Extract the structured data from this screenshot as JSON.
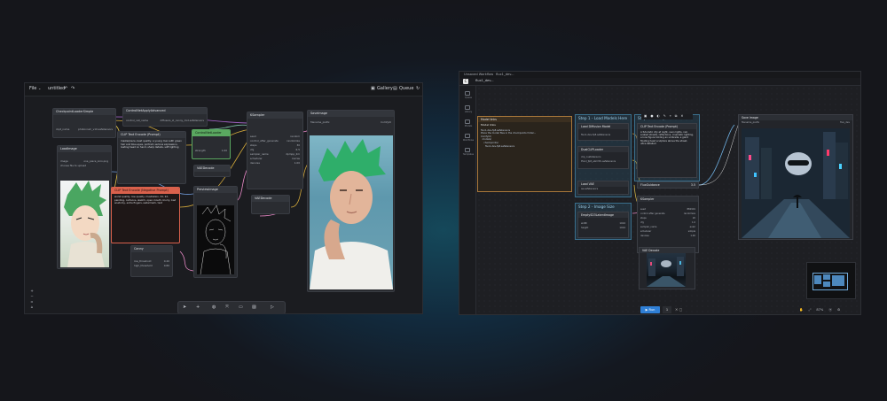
{
  "left_window": {
    "menu": {
      "file": "File",
      "file_chevron": "chevron-down-icon",
      "workflow": "untitled"
    },
    "top_right": {
      "gallery": "Gallery",
      "queue": "Queue"
    },
    "nodes": {
      "checkpoint": {
        "title": "CheckpointLoaderSimple",
        "ckpt_name": "ckpt_name",
        "ckpt_value": "photonium_v10.safetensors"
      },
      "controlnet_apply": {
        "title": "ControlNetApplyAdvanced",
        "field": "control_net_name",
        "value": "diffusers_xl_canny_mid.safetensors"
      },
      "clip_pos": {
        "title": "CLIP Text Encode (Prompt)",
        "text": "masterpiece, best quality, a young man with green hair and blue-eyes, portrait, serious expression, resting head on hand, sharp details, soft lighting"
      },
      "clip_neg": {
        "title": "CLIP Text Encode (Negative Prompt)",
        "text": "worst quality, low quality, illustration, 3d, 2d, painting, cartoons, sketch, open mouth, blurry, bad anatomy, extra fingers, watermark, text"
      },
      "load_image": {
        "title": "LoadImage",
        "image_label": "image",
        "image_value": "one_piece_zoro.png",
        "upload": "choose file to upload"
      },
      "canny": {
        "title": "Canny",
        "low": "low_threshold",
        "low_v": "0.40",
        "high": "high_threshold",
        "high_v": "0.80"
      },
      "green": {
        "title": "ControlNetLoader",
        "strength": "strength",
        "strength_v": "1.00"
      },
      "vae_decode": {
        "title": "VAEDecode"
      },
      "preview": {
        "title": "PreviewImage"
      },
      "ksampler": {
        "title": "KSampler",
        "rows": [
          {
            "k": "seed",
            "v": "random"
          },
          {
            "k": "control_after_generate",
            "v": "randomize"
          },
          {
            "k": "steps",
            "v": "30"
          },
          {
            "k": "cfg",
            "v": "6.5"
          },
          {
            "k": "sampler_name",
            "v": "dpmpp_2m"
          },
          {
            "k": "scheduler",
            "v": "karras"
          },
          {
            "k": "denoise",
            "v": "1.00"
          }
        ]
      },
      "vae_encode": {
        "title": "VAEDecode"
      },
      "save_image": {
        "title": "SaveImage",
        "prefix": "filename_prefix",
        "prefix_v": "ComfyUI"
      }
    },
    "toolbar": {
      "icons": [
        "select-icon",
        "add-icon",
        "globe-icon",
        "fit-icon",
        "lock-icon",
        "image-icon",
        "play-icon"
      ]
    }
  },
  "right_window": {
    "tabs": [
      "Unsaved Workflow",
      "flux1_dev..."
    ],
    "subtab": "flux1_dev...",
    "sidebar": [
      {
        "icon": "queue-icon",
        "label": "Queue"
      },
      {
        "icon": "library-icon",
        "label": "Library"
      },
      {
        "icon": "model-icon",
        "label": "Models"
      },
      {
        "icon": "workflow-icon",
        "label": "Workflows"
      },
      {
        "icon": "templates-icon",
        "label": "Templates"
      }
    ],
    "model_links": {
      "title": "Model links",
      "label": "Model links",
      "text": "flux1-dev-fp8.safetensors\nPlace the model files in the checkpoints folder...\nComfyUI/\n  models/\n    checkpoints/\n      flux1-dev-fp8.safetensors"
    },
    "groups": {
      "step1": "Step 1 - Load Models Here",
      "step2": "Step 2 - Image Size",
      "step3": "Step 3 - Prompt"
    },
    "nodes": {
      "load_diffusion": {
        "title": "Load Diffusion Model",
        "value": "flux1-dev-fp8.safetensors"
      },
      "dual_clip": {
        "title": "DualCLIPLoader",
        "v1": "clip_l.safetensors",
        "v2": "t5xxl_fp8_e4m3fn.safetensors"
      },
      "load_vae": {
        "title": "Load VAE",
        "value": "ae.safetensors"
      },
      "empty_latent": {
        "title": "EmptySD3LatentImage",
        "w": "1024",
        "h": "1024"
      },
      "clip_text": {
        "title": "CLIP Text Encode (Prompt)",
        "text": "A futuristic city at night, neon lights, rain soaked streets, reflections, cinematic lighting, a lone figure holding an umbrella, a giant floating head sculpture above the street, ultra-detailed"
      },
      "flux_guidance": {
        "title": "FluxGuidance",
        "value": "3.5"
      },
      "ksampler": {
        "title": "KSampler",
        "rows": [
          {
            "k": "seed",
            "v": "882901"
          },
          {
            "k": "control after generate",
            "v": "randomize"
          },
          {
            "k": "steps",
            "v": "20"
          },
          {
            "k": "cfg",
            "v": "1.0"
          },
          {
            "k": "sampler_name",
            "v": "euler"
          },
          {
            "k": "scheduler",
            "v": "simple"
          },
          {
            "k": "denoise",
            "v": "1.00"
          }
        ]
      },
      "vae_decode": {
        "title": "VAE Decode"
      },
      "save_image": {
        "title": "Save Image",
        "prefix": "filename_prefix",
        "prefix_v": "flux_dev"
      }
    },
    "bottom": {
      "run": "Run",
      "count": "1",
      "zoom": "87%"
    }
  },
  "colors": {
    "accent_blue": "#2f7fd6",
    "neg_node": "#d9614c",
    "green_node": "#5aa860",
    "group_border": "#3a6f8c"
  }
}
